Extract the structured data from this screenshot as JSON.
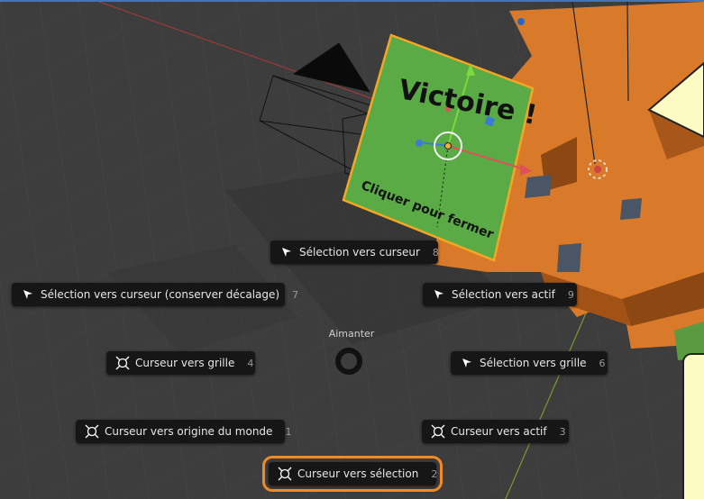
{
  "viewport": {
    "colors": {
      "background": "#3d3d3d",
      "level": "#d97a2a",
      "card": "#5aaa45",
      "selection_outline": "#f5a623",
      "pie_item": "#161616",
      "active_outline": "#f08a24"
    }
  },
  "card": {
    "title": "Victoire !",
    "subtitle": "Cliquer pour fermer"
  },
  "pie_menu": {
    "title": "Aimanter",
    "items": [
      {
        "id": "sel-to-cursor",
        "label": "Sélection vers curseur",
        "key": "8",
        "icon": "cursor-arrow-icon"
      },
      {
        "id": "sel-to-cursor-offset",
        "label": "Sélection vers curseur (conserver décalage)",
        "key": "7",
        "icon": "cursor-arrow-icon"
      },
      {
        "id": "sel-to-active",
        "label": "Sélection vers actif",
        "key": "9",
        "icon": "cursor-arrow-icon"
      },
      {
        "id": "cursor-to-grid",
        "label": "Curseur vers grille",
        "key": "4",
        "icon": "3d-cursor-icon"
      },
      {
        "id": "sel-to-grid",
        "label": "Sélection vers grille",
        "key": "6",
        "icon": "cursor-arrow-icon"
      },
      {
        "id": "cursor-to-origin",
        "label": "Curseur vers origine du monde",
        "key": "1",
        "icon": "3d-cursor-icon"
      },
      {
        "id": "cursor-to-active",
        "label": "Curseur vers actif",
        "key": "3",
        "icon": "3d-cursor-icon"
      },
      {
        "id": "cursor-to-selection",
        "label": "Curseur vers sélection",
        "key": "2",
        "icon": "3d-cursor-icon",
        "active": true
      }
    ]
  }
}
